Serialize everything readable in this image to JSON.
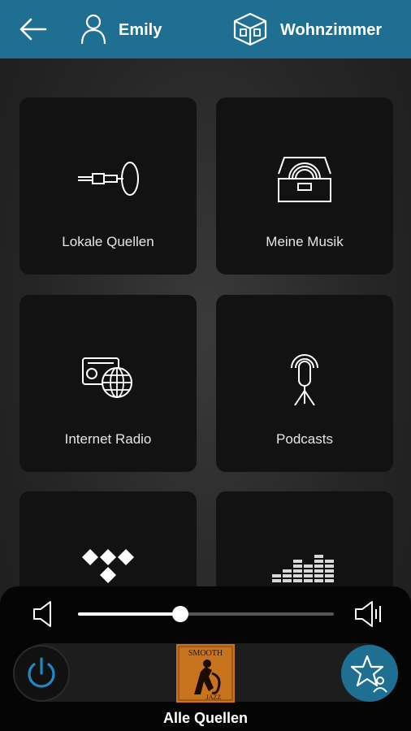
{
  "header": {
    "user_name": "Emily",
    "room_name": "Wohnzimmer",
    "back_icon": "arrow-left-icon",
    "user_icon": "person-icon",
    "room_icon": "room-cube-icon"
  },
  "tiles": [
    {
      "label": "Lokale Quellen",
      "icon": "aux-cable-icon"
    },
    {
      "label": "Meine Musik",
      "icon": "record-box-icon"
    },
    {
      "label": "Internet Radio",
      "icon": "radio-globe-icon"
    },
    {
      "label": "Podcasts",
      "icon": "microphone-icon"
    },
    {
      "label": "",
      "icon": "tidal-logo-icon"
    },
    {
      "label": "",
      "icon": "equalizer-icon"
    }
  ],
  "player": {
    "volume_fraction": 0.4,
    "source_label": "Alle Quellen",
    "album_art_text_top": "SMOOTH",
    "album_art_text_bottom": "JAZZ",
    "colors": {
      "accent": "#1f6f93",
      "power": "#1e88c8"
    }
  }
}
